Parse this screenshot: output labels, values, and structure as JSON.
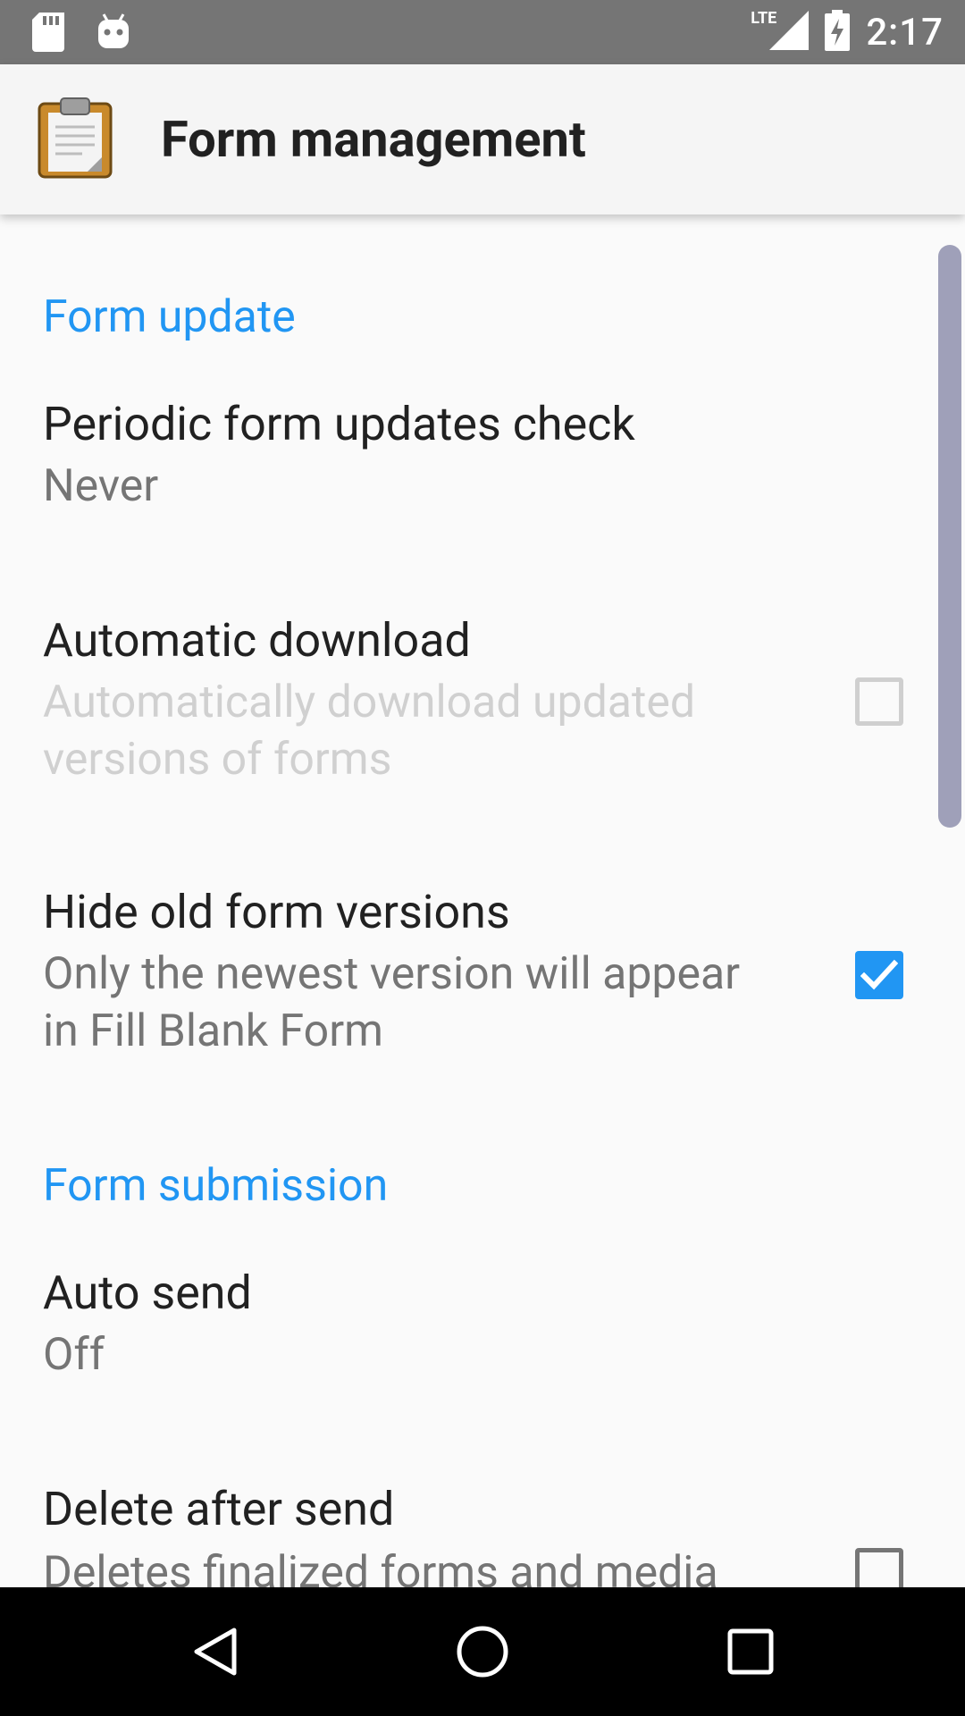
{
  "status_bar": {
    "left_icons": [
      "sd-card-icon",
      "android-debug-icon"
    ],
    "network": "LTE",
    "battery_state": "charging",
    "time": "2:17"
  },
  "app_bar": {
    "icon": "clipboard-icon",
    "title": "Form management"
  },
  "sections": {
    "form_update": {
      "header": "Form update",
      "periodic_check": {
        "title": "Periodic form updates check",
        "summary": "Never"
      },
      "automatic_download": {
        "title": "Automatic download",
        "summary": "Automatically download updated versions of forms",
        "checked": false,
        "enabled": false
      },
      "hide_old_versions": {
        "title": "Hide old form versions",
        "summary": "Only the newest version will appear in Fill Blank Form",
        "checked": true,
        "enabled": true
      }
    },
    "form_submission": {
      "header": "Form submission",
      "auto_send": {
        "title": "Auto send",
        "summary": "Off"
      },
      "delete_after_send": {
        "title": "Delete after send",
        "summary": "Deletes finalized forms and media",
        "checked": false,
        "enabled": true
      }
    }
  },
  "nav_bar": {
    "buttons": [
      "back-icon",
      "home-icon",
      "recents-icon"
    ]
  },
  "colors": {
    "accent": "#2196f3",
    "status_bar": "#757575",
    "app_bar": "#f5f5f5",
    "background": "#fafafa",
    "scrollbar": "#9fa0b9"
  }
}
